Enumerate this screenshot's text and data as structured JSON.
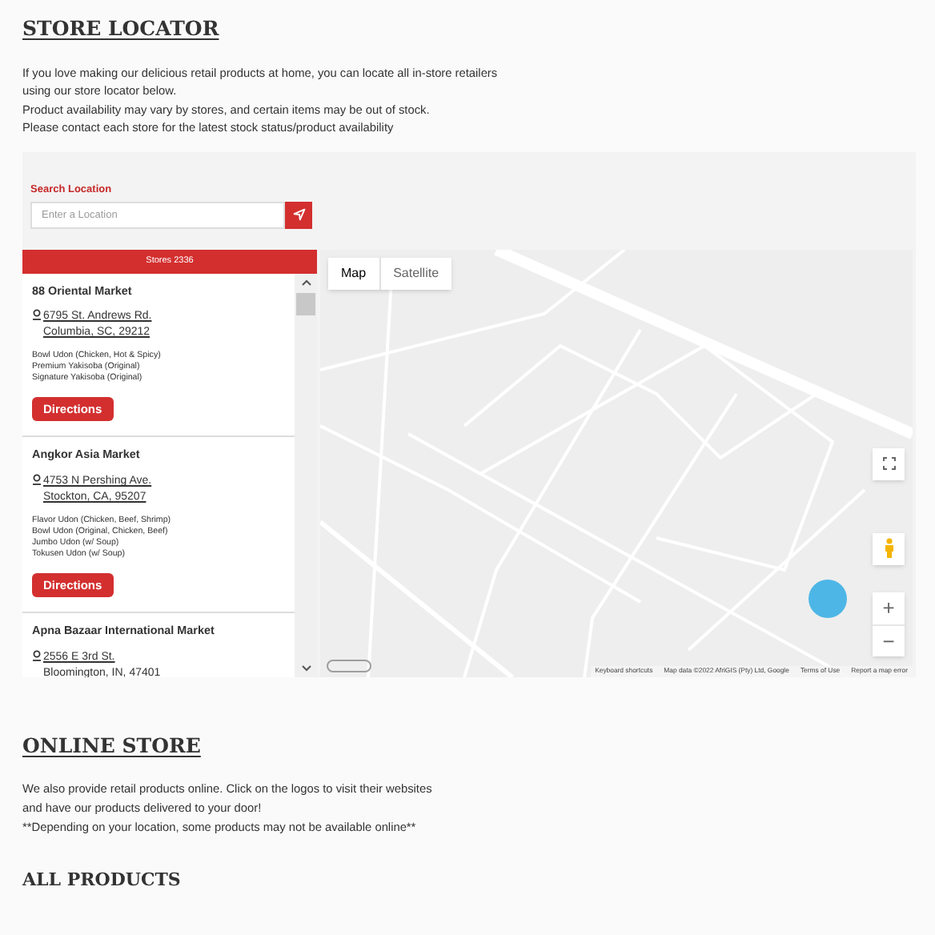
{
  "store_locator": {
    "title": "STORE LOCATOR",
    "intro": [
      "If you love making our delicious retail products at home, you can locate all in-store retailers using our store locator below.",
      "Product availability may vary by stores, and certain items may be out of stock.",
      "Please contact each store for the latest stock status/product availability"
    ],
    "search": {
      "label": "Search Location",
      "placeholder": "Enter a Location"
    },
    "stores_header": "Stores 2336",
    "stores": [
      {
        "name": "88 Oriental Market",
        "address": [
          "6795 St. Andrews Rd.",
          "Columbia, SC, 29212"
        ],
        "products": [
          "Bowl Udon (Chicken, Hot & Spicy)",
          "Premium Yakisoba (Original)",
          "Signature Yakisoba (Original)"
        ],
        "button": "Directions"
      },
      {
        "name": "Angkor Asia Market",
        "address": [
          "4753 N Pershing Ave.",
          "Stockton, CA, 95207"
        ],
        "products": [
          "Flavor Udon (Chicken, Beef, Shrimp)",
          "Bowl Udon (Original, Chicken, Beef)",
          "Jumbo Udon (w/ Soup)",
          "Tokusen Udon (w/ Soup)"
        ],
        "button": "Directions"
      },
      {
        "name": "Apna Bazaar International Market",
        "address": [
          "2556 E 3rd St.",
          "Bloomington, IN, 47401"
        ]
      }
    ],
    "map": {
      "types": [
        {
          "label": "Map",
          "selected": true
        },
        {
          "label": "Satellite",
          "selected": false
        }
      ],
      "zoom_in": "+",
      "zoom_out": "−",
      "footer": [
        "Keyboard shortcuts",
        "Map data ©2022 AfriGIS (Pty) Ltd, Google",
        "Terms of Use",
        "Report a map error"
      ]
    }
  },
  "online_store": {
    "title": "ONLINE STORE",
    "text": [
      "We also provide retail products online. Click on the logos to visit their websites and have our products delivered to your door!",
      "**Depending on your location, some products may not be available online**"
    ]
  },
  "all_products": {
    "title": "ALL PRODUCTS"
  }
}
